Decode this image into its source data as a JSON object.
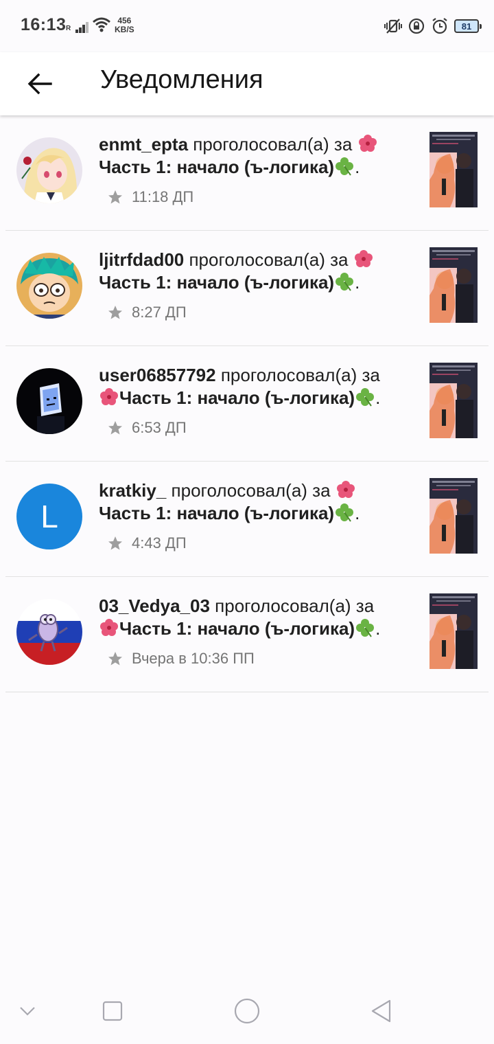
{
  "status_bar": {
    "time": "16:13",
    "network_label": "R",
    "speed_value": "456",
    "speed_unit": "KB/S",
    "battery": "81"
  },
  "header": {
    "title": "Уведомления",
    "back_icon": "arrow-back-icon"
  },
  "notifications": [
    {
      "username": "enmt_epta",
      "action": " проголосовал(а) за ",
      "story": "Часть 1: начало (ъ-логика)",
      "suffix": ".",
      "time": "11:18 ДП",
      "avatar_type": "anime-blonde"
    },
    {
      "username": "ljitrfdad00",
      "action": " проголосовал(а) за ",
      "story": "Часть 1: начало (ъ-логика)",
      "suffix": ".",
      "time": "8:27 ДП",
      "avatar_type": "cartoon-green-hair"
    },
    {
      "username": "user06857792",
      "action": " проголосовал(а) за ",
      "story": "Часть 1: начало (ъ-логика)",
      "suffix": ".",
      "time": "6:53 ДП",
      "avatar_type": "dark-screen"
    },
    {
      "username": "kratkiy_",
      "action": " проголосовал(а) за ",
      "story": "Часть 1: начало (ъ-логика)",
      "suffix": ".",
      "time": "4:43 ДП",
      "avatar_type": "letter",
      "avatar_letter": "L"
    },
    {
      "username": "03_Vedya_03",
      "action": " проголосовал(а) за ",
      "story": "Часть 1: начало (ъ-логика)",
      "suffix": ".",
      "time": "Вчера в 10:36 ПП",
      "avatar_type": "flag-character"
    }
  ],
  "nav_bar": {
    "icons": [
      "chevron-down-icon",
      "recents-square-icon",
      "home-circle-icon",
      "back-triangle-icon"
    ]
  },
  "colors": {
    "accent_blue": "#1a86dc",
    "time_gray": "#757575",
    "divider": "#e2e2e2"
  }
}
